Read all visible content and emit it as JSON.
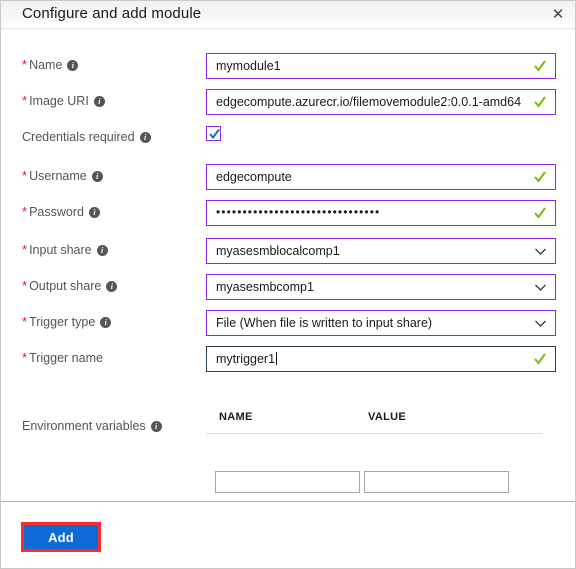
{
  "header": {
    "title": "Configure and add module",
    "close_label": "✕"
  },
  "form": {
    "fields": [
      {
        "label": "Name",
        "required": true,
        "info": true,
        "value": "mymodule1",
        "kind": "text",
        "state": "valid"
      },
      {
        "label": "Image URI",
        "required": true,
        "info": true,
        "value": "edgecompute.azurecr.io/filemovemodule2:0.0.1-amd64",
        "kind": "text",
        "state": "valid"
      },
      {
        "label": "Credentials required",
        "required": false,
        "info": true,
        "value": "",
        "kind": "checkbox",
        "state": "checked"
      },
      {
        "label": "Username",
        "required": true,
        "info": true,
        "value": "edgecompute",
        "kind": "text",
        "state": "valid"
      },
      {
        "label": "Password",
        "required": true,
        "info": true,
        "value": "•••••••••••••••••••••••••••••••",
        "kind": "password",
        "state": "valid"
      },
      {
        "label": "Input share",
        "required": true,
        "info": true,
        "value": "myasesmblocalcomp1",
        "kind": "select",
        "state": "normal"
      },
      {
        "label": "Output share",
        "required": true,
        "info": true,
        "value": "myasesmbcomp1",
        "kind": "select",
        "state": "normal"
      },
      {
        "label": "Trigger type",
        "required": true,
        "info": true,
        "value": "File  (When file is written to input share)",
        "kind": "select",
        "state": "normal"
      },
      {
        "label": "Trigger name",
        "required": true,
        "info": false,
        "value": "mytrigger1",
        "kind": "text",
        "state": "focused-valid"
      },
      {
        "label": "Environment variables",
        "required": false,
        "info": true,
        "value": "",
        "kind": "label-only",
        "state": "normal"
      }
    ]
  },
  "env_table": {
    "columns": [
      "NAME",
      "VALUE"
    ],
    "rows": [
      {
        "name": "",
        "value": ""
      }
    ],
    "name_placeholder": "",
    "value_placeholder": ""
  },
  "footer": {
    "add_label": "Add"
  },
  "colors": {
    "accent_purple": "#8a2be2",
    "valid_green": "#7fba00",
    "checkbox_blue": "#0078d7",
    "button_blue": "#0d6ad6",
    "highlight_red": "#ff2b2b",
    "required_red": "#e81123"
  }
}
